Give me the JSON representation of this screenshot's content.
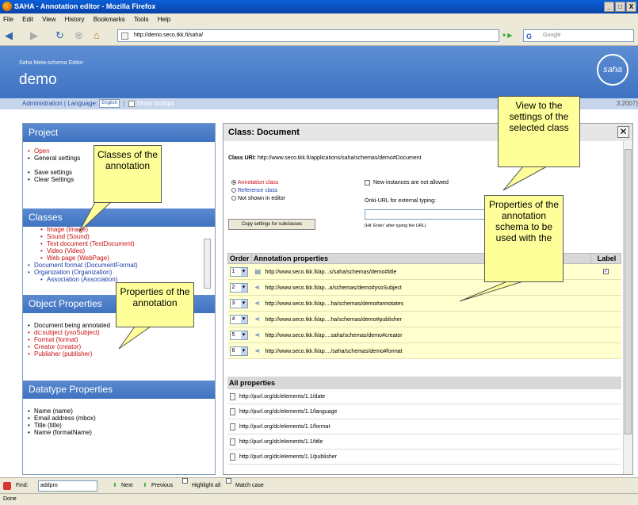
{
  "window": {
    "title": "SAHA - Annotation editor - Mozilla Firefox",
    "controls": [
      "_",
      "□",
      "X"
    ]
  },
  "menu": [
    "File",
    "Edit",
    "View",
    "History",
    "Bookmarks",
    "Tools",
    "Help"
  ],
  "nav": {
    "url": "http://demo.seco.tkk.fi/saha/",
    "search_placeholder": "Google"
  },
  "header": {
    "subtitle": "Saha Meta-schema Editor",
    "title": "demo",
    "logo": "saha"
  },
  "adminbar": {
    "admin": "Administration",
    "sep": "|",
    "language_label": "Language:",
    "language_value": "English",
    "tooltips": "Show tooltips",
    "version": "3.2007)"
  },
  "left": {
    "project": {
      "title": "Project",
      "items": [
        "Open",
        "General settings",
        "Save settings",
        "Clear Settings"
      ]
    },
    "classes": {
      "title": "Classes",
      "sub_items": [
        "Image (Image)",
        "Sound (Sound)",
        "Text document (TextDocument)",
        "Video (Video)",
        "Web page (WebPage)"
      ],
      "items": [
        "Document format (DocumentFormat)",
        "Organization (Organization)"
      ],
      "sub2": [
        "Association (Association)"
      ]
    },
    "object_properties": {
      "title": "Object Properties",
      "items": [
        "Document being annotated",
        "dc:subject (ysoSubject)",
        "Format (format)",
        "Creator (creator)",
        "Publisher (publisher)"
      ]
    },
    "datatype_properties": {
      "title": "Datatype Properties",
      "items": [
        "Name (name)",
        "Email address (mbox)",
        "Title (title)",
        "Name (formatName)"
      ]
    }
  },
  "main": {
    "title": "Class: Document",
    "class_uri_label": "Class URI:",
    "class_uri": "http://www.seco.tkk.fi/applications/saha/schemas/demo#Document",
    "radios": [
      "Annotation class",
      "Reference class",
      "Not shown in editor"
    ],
    "new_instances": "New instances are not allowed",
    "onki_label": "Onki-URL for external typing:",
    "onki_hint": "(Hit 'Enter' after typing the URL)",
    "copy_button": "Copy settings for subclasses",
    "table": {
      "headers": [
        "Order",
        "Annotation properties",
        "Label"
      ],
      "rows": [
        {
          "order": "1",
          "uri": "http://www.seco.tkk.fi/ap...s/saha/schemas/demo#title",
          "label": "✓"
        },
        {
          "order": "2",
          "uri": "http://www.seco.tkk.fi/ap...a/schemas/demo#ysoSubject",
          "label": ""
        },
        {
          "order": "3",
          "uri": "http://www.seco.tkk.fi/ap....ha/schemas/demo#annotates",
          "label": ""
        },
        {
          "order": "4",
          "uri": "http://www.seco.tkk.fi/ap....ha/schemas/demo#publisher",
          "label": ""
        },
        {
          "order": "5",
          "uri": "http://www.seco.tkk.fi/ap....saha/schemas/demo#creator",
          "label": ""
        },
        {
          "order": "6",
          "uri": "http://www.seco.tkk.fi/ap..../saha/schemas/demo#format",
          "label": ""
        }
      ]
    },
    "all_properties": {
      "title": "All properties",
      "items": [
        "http://purl.org/dc/elements/1.1/date",
        "http://purl.org/dc/elements/1.1/language",
        "http://purl.org/dc/elements/1.1/format",
        "http://purl.org/dc/elements/1.1/title",
        "http://purl.org/dc/elements/1.1/publisher"
      ]
    }
  },
  "callouts": {
    "classes": "Classes of the annotation",
    "properties": "Properties of the annotation",
    "view": "View to the settings of the selected class",
    "schema": "Properties of the annotation schema to be used with the"
  },
  "findbar": {
    "label": "Find:",
    "value": "addpro",
    "next": "Next",
    "previous": "Previous",
    "highlight": "Highlight all",
    "match": "Match case"
  },
  "status": "Done"
}
